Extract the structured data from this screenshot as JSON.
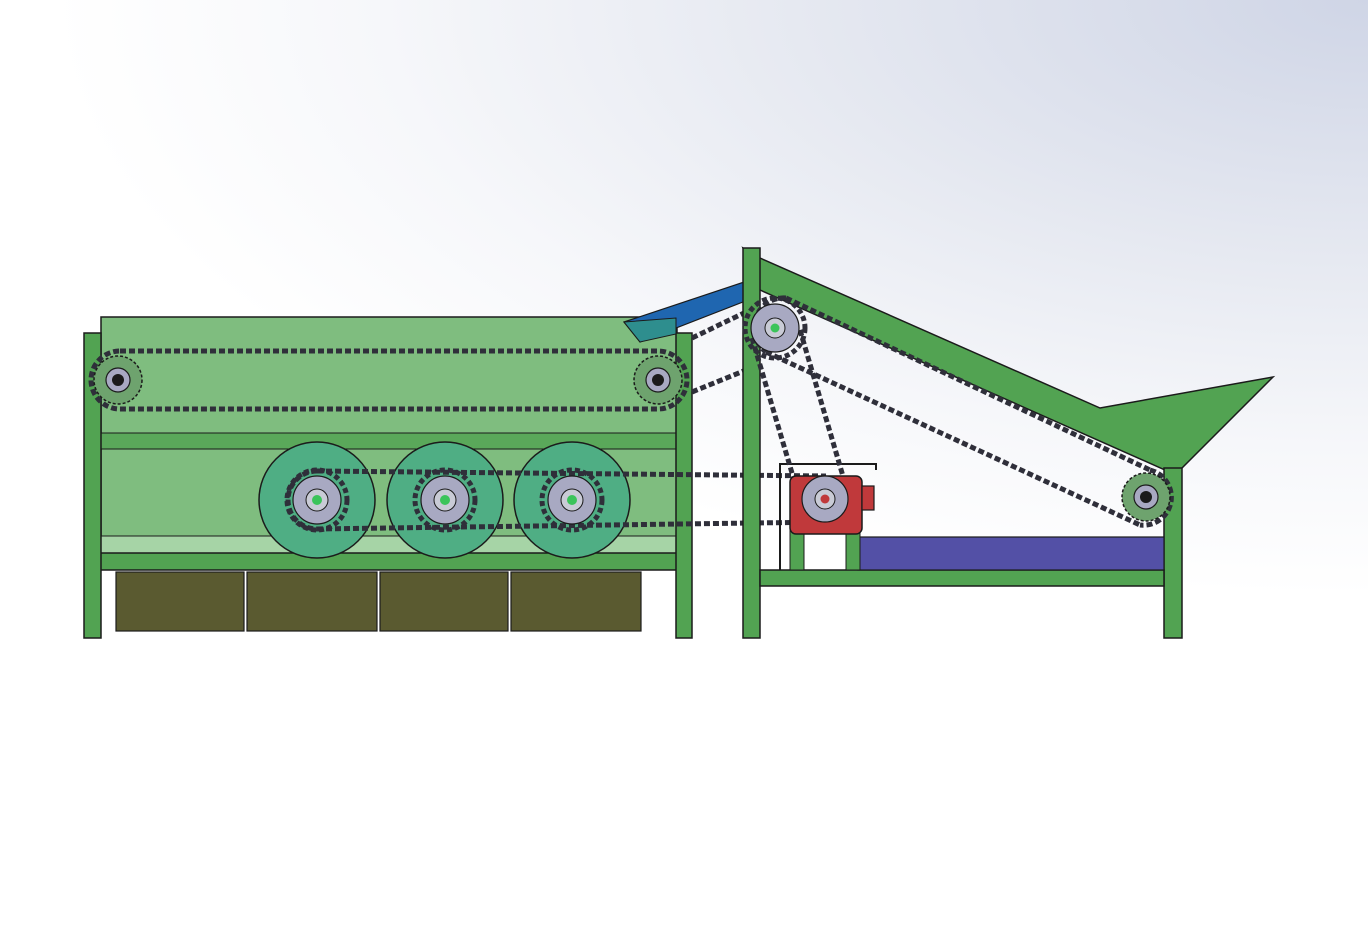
{
  "drawing": {
    "colors": {
      "background_top": "#cfd5e6",
      "background_bottom": "#ffffff",
      "frame_green": "#52a352",
      "housing_green": "#7fbd7f",
      "drum_teal": "#4fae84",
      "sprocket_gray": "#a8a9c2",
      "chain_dark": "#2f2f3a",
      "chute_blue": "#1f66b0",
      "chute_teal": "#2e8e8e",
      "motor_red": "#c0393b",
      "tray_purple": "#5350a6",
      "bin_olive": "#5a5a30",
      "outline": "#1b1b1b"
    },
    "icons": {
      "sprocket": "sprocket-icon",
      "drum": "drum-icon",
      "motor": "motor-icon"
    }
  }
}
